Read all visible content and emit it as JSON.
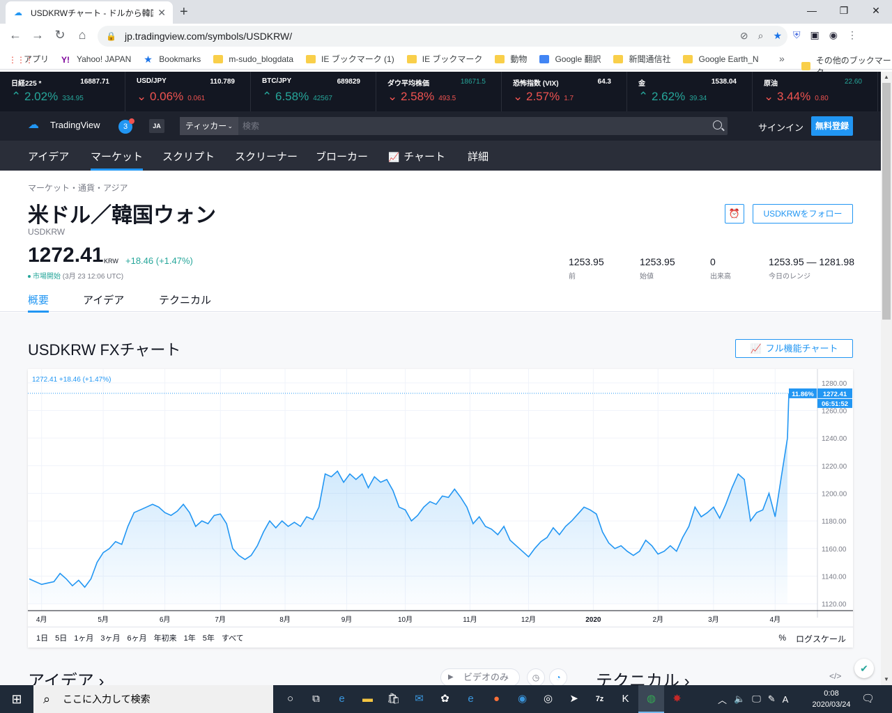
{
  "browser": {
    "tab_title": "USDKRWチャート - ドルから韓国ウォ",
    "url": "jp.tradingview.com/symbols/USDKRW/",
    "bookmarks": [
      "アプリ",
      "Yahoo! JAPAN",
      "Bookmarks",
      "m-sudo_blogdata",
      "IE ブックマーク (1)",
      "IE ブックマーク",
      "動物",
      "Google 翻訳",
      "新聞通信社",
      "Google Earth_N"
    ],
    "other_bookmarks": "その他のブックマーク"
  },
  "ticker_tape": [
    {
      "name": "日経225 *",
      "value": "16887.71",
      "change": "2.02%",
      "abs": "334.95",
      "dir": "up"
    },
    {
      "name": "USD/JPY",
      "value": "110.789",
      "change": "0.06%",
      "abs": "0.061",
      "dir": "down"
    },
    {
      "name": "BTC/JPY",
      "value": "689829",
      "change": "6.58%",
      "abs": "42567",
      "dir": "up"
    },
    {
      "name": "ダウ平均株価",
      "value": "18671.5",
      "change": "2.58%",
      "abs": "493.5",
      "dir": "down"
    },
    {
      "name": "恐怖指数 (VIX)",
      "value": "64.3",
      "change": "2.57%",
      "abs": "1.7",
      "dir": "down"
    },
    {
      "name": "金",
      "value": "1538.04",
      "change": "2.62%",
      "abs": "39.34",
      "dir": "up"
    },
    {
      "name": "原油",
      "value": "22.60",
      "change": "3.44%",
      "abs": "0.80",
      "dir": "down"
    }
  ],
  "header": {
    "logo": "TradingView",
    "notifications": "3",
    "lang": "JA",
    "ticker_select": "ティッカー",
    "search_placeholder": "検索",
    "signin": "サインイン",
    "signup": "無料登録"
  },
  "nav": [
    "アイデア",
    "マーケット",
    "スクリプト",
    "スクリーナー",
    "ブローカー",
    "チャート",
    "詳細"
  ],
  "symbol": {
    "breadcrumb": "マーケット・通貨・アジア",
    "title": "米ドル／韓国ウォン",
    "code": "USDKRW",
    "follow": "USDKRWをフォロー",
    "price": "1272.41",
    "currency": "KRW",
    "change": "+18.46 (+1.47%)",
    "status": "市場開始",
    "status_time": "(3月 23 12:06 UTC)",
    "stats": [
      {
        "value": "1253.95",
        "label": "前"
      },
      {
        "value": "1253.95",
        "label": "始値"
      },
      {
        "value": "0",
        "label": "出来高"
      },
      {
        "value": "1253.95 — 1281.98",
        "label": "今日のレンジ"
      }
    ],
    "tabs": [
      "概要",
      "アイデア",
      "テクニカル"
    ]
  },
  "chart_section": {
    "title": "USDKRW FXチャート",
    "full_chart": "フル機能チャート",
    "ranges": [
      "1日",
      "5日",
      "1ヶ月",
      "3ヶ月",
      "6ヶ月",
      "年初来",
      "1年",
      "5年",
      "すべて"
    ],
    "percent": "%",
    "log": "ログスケール"
  },
  "chart_data": {
    "type": "area",
    "legend_text": "1272.41  +18.46 (+1.47%)",
    "ylim": [
      1115,
      1290
    ],
    "yticks": [
      1120,
      1140,
      1160,
      1180,
      1200,
      1220,
      1240,
      1260,
      1280
    ],
    "ytick_labels": [
      "1120.00",
      "1140.00",
      "1160.00",
      "1180.00",
      "1200.00",
      "1220.00",
      "1240.00",
      "1260.00",
      "1280.00"
    ],
    "xticks": [
      {
        "label": "4月",
        "t": 0.2
      },
      {
        "label": "5月",
        "t": 1.2
      },
      {
        "label": "6月",
        "t": 2.2
      },
      {
        "label": "7月",
        "t": 3.1
      },
      {
        "label": "8月",
        "t": 4.15
      },
      {
        "label": "9月",
        "t": 5.15
      },
      {
        "label": "10月",
        "t": 6.1
      },
      {
        "label": "11月",
        "t": 7.15
      },
      {
        "label": "12月",
        "t": 8.1
      },
      {
        "label": "2020",
        "t": 9.15
      },
      {
        "label": "2月",
        "t": 10.2
      },
      {
        "label": "3月",
        "t": 11.1
      },
      {
        "label": "4月",
        "t": 12.1
      }
    ],
    "xlim": [
      0,
      12.3
    ],
    "last_label": "1272.41",
    "pct_label": "11.86%",
    "countdown": "06:51:52",
    "values": [
      [
        0.0,
        1138
      ],
      [
        0.1,
        1136
      ],
      [
        0.2,
        1134
      ],
      [
        0.3,
        1135
      ],
      [
        0.4,
        1136
      ],
      [
        0.5,
        1142
      ],
      [
        0.6,
        1138
      ],
      [
        0.7,
        1133
      ],
      [
        0.8,
        1137
      ],
      [
        0.9,
        1132
      ],
      [
        1.0,
        1138
      ],
      [
        1.1,
        1150
      ],
      [
        1.2,
        1157
      ],
      [
        1.3,
        1160
      ],
      [
        1.4,
        1165
      ],
      [
        1.5,
        1163
      ],
      [
        1.6,
        1176
      ],
      [
        1.7,
        1186
      ],
      [
        1.8,
        1188
      ],
      [
        1.9,
        1190
      ],
      [
        2.0,
        1192
      ],
      [
        2.1,
        1190
      ],
      [
        2.2,
        1186
      ],
      [
        2.3,
        1184
      ],
      [
        2.4,
        1187
      ],
      [
        2.5,
        1192
      ],
      [
        2.6,
        1186
      ],
      [
        2.7,
        1176
      ],
      [
        2.8,
        1180
      ],
      [
        2.9,
        1178
      ],
      [
        3.0,
        1184
      ],
      [
        3.1,
        1185
      ],
      [
        3.2,
        1178
      ],
      [
        3.3,
        1160
      ],
      [
        3.4,
        1155
      ],
      [
        3.5,
        1152
      ],
      [
        3.6,
        1155
      ],
      [
        3.7,
        1162
      ],
      [
        3.8,
        1172
      ],
      [
        3.9,
        1180
      ],
      [
        4.0,
        1175
      ],
      [
        4.1,
        1180
      ],
      [
        4.2,
        1176
      ],
      [
        4.3,
        1179
      ],
      [
        4.4,
        1176
      ],
      [
        4.5,
        1183
      ],
      [
        4.6,
        1181
      ],
      [
        4.7,
        1190
      ],
      [
        4.8,
        1214
      ],
      [
        4.9,
        1212
      ],
      [
        5.0,
        1216
      ],
      [
        5.1,
        1208
      ],
      [
        5.2,
        1214
      ],
      [
        5.3,
        1210
      ],
      [
        5.4,
        1214
      ],
      [
        5.5,
        1204
      ],
      [
        5.6,
        1212
      ],
      [
        5.7,
        1208
      ],
      [
        5.8,
        1210
      ],
      [
        5.9,
        1202
      ],
      [
        6.0,
        1190
      ],
      [
        6.1,
        1188
      ],
      [
        6.2,
        1180
      ],
      [
        6.3,
        1184
      ],
      [
        6.4,
        1190
      ],
      [
        6.5,
        1194
      ],
      [
        6.6,
        1192
      ],
      [
        6.7,
        1198
      ],
      [
        6.8,
        1197
      ],
      [
        6.9,
        1203
      ],
      [
        7.0,
        1197
      ],
      [
        7.1,
        1190
      ],
      [
        7.2,
        1178
      ],
      [
        7.3,
        1183
      ],
      [
        7.4,
        1176
      ],
      [
        7.5,
        1174
      ],
      [
        7.6,
        1170
      ],
      [
        7.7,
        1176
      ],
      [
        7.8,
        1166
      ],
      [
        7.9,
        1162
      ],
      [
        8.0,
        1158
      ],
      [
        8.1,
        1154
      ],
      [
        8.2,
        1160
      ],
      [
        8.3,
        1165
      ],
      [
        8.4,
        1168
      ],
      [
        8.5,
        1175
      ],
      [
        8.6,
        1170
      ],
      [
        8.7,
        1176
      ],
      [
        8.8,
        1180
      ],
      [
        8.9,
        1185
      ],
      [
        9.0,
        1190
      ],
      [
        9.1,
        1188
      ],
      [
        9.2,
        1185
      ],
      [
        9.3,
        1172
      ],
      [
        9.4,
        1164
      ],
      [
        9.5,
        1160
      ],
      [
        9.6,
        1162
      ],
      [
        9.7,
        1158
      ],
      [
        9.8,
        1155
      ],
      [
        9.9,
        1158
      ],
      [
        10.0,
        1166
      ],
      [
        10.1,
        1162
      ],
      [
        10.2,
        1156
      ],
      [
        10.3,
        1158
      ],
      [
        10.4,
        1162
      ],
      [
        10.5,
        1158
      ],
      [
        10.6,
        1168
      ],
      [
        10.7,
        1176
      ],
      [
        10.8,
        1190
      ],
      [
        10.9,
        1183
      ],
      [
        11.0,
        1186
      ],
      [
        11.1,
        1190
      ],
      [
        11.2,
        1182
      ],
      [
        11.3,
        1192
      ],
      [
        11.4,
        1204
      ],
      [
        11.5,
        1214
      ],
      [
        11.6,
        1210
      ],
      [
        11.7,
        1180
      ],
      [
        11.8,
        1186
      ],
      [
        11.9,
        1188
      ],
      [
        12.0,
        1200
      ],
      [
        12.1,
        1183
      ],
      [
        12.2,
        1212
      ],
      [
        12.3,
        1240
      ]
    ]
  },
  "below": {
    "ideas": "アイデア ›",
    "video_only": "ビデオのみ",
    "technical": "テクニカル ›"
  },
  "taskbar": {
    "search_placeholder": "ここに入力して検索",
    "time": "0:08",
    "date": "2020/03/24"
  }
}
